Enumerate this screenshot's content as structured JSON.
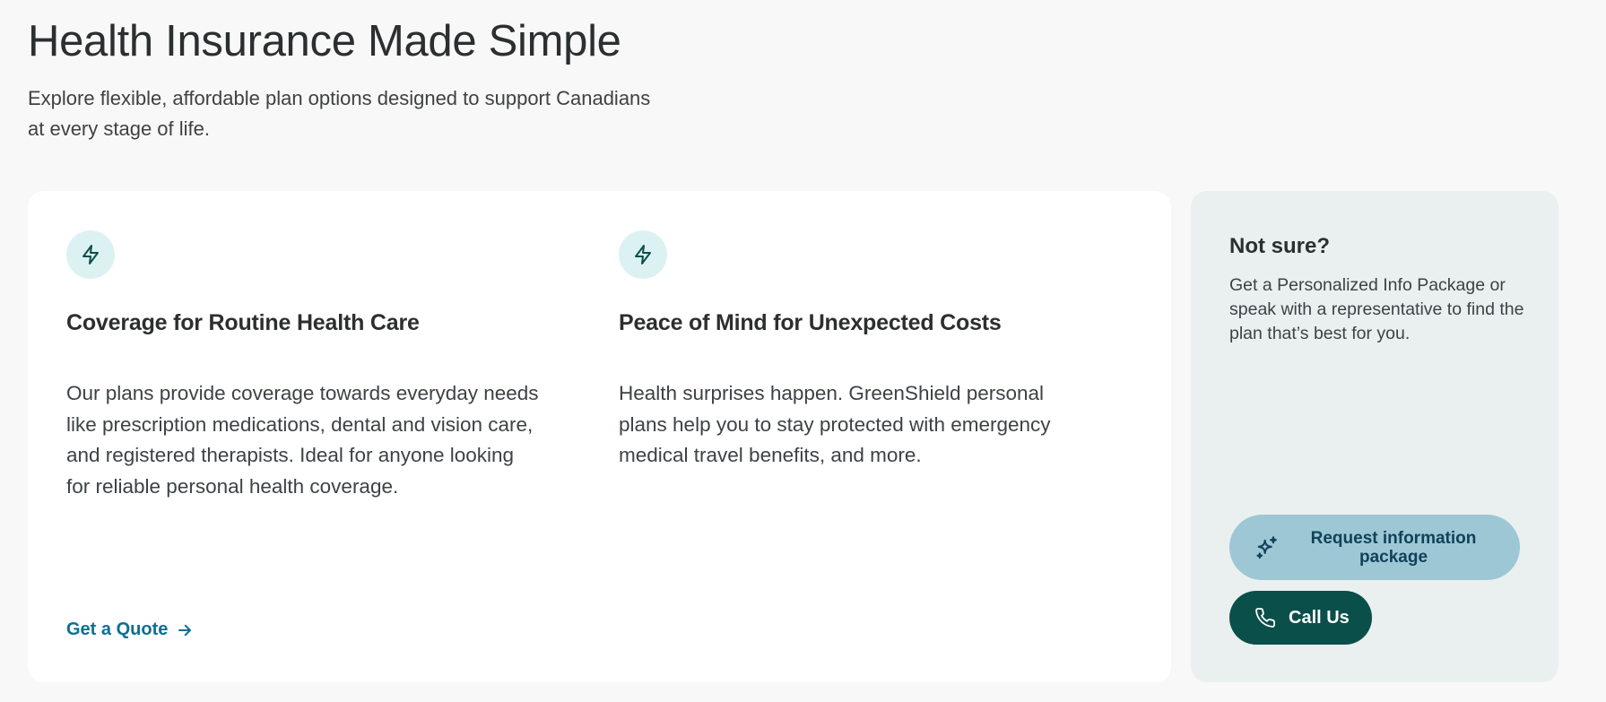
{
  "hero": {
    "title": "Health Insurance Made Simple",
    "subtitle": "Explore flexible, affordable plan options designed to support Canadians at every stage of life."
  },
  "features": [
    {
      "icon": "lightning-icon",
      "heading": "Coverage for Routine Health Care",
      "body": "Our plans provide coverage towards everyday needs like prescription medications, dental and vision care, and registered therapists. Ideal for anyone looking for reliable personal health coverage."
    },
    {
      "icon": "lightning-icon",
      "heading": "Peace of Mind for Unexpected Costs",
      "body": "Health surprises happen. GreenShield personal plans help you to stay protected with emergency medical travel benefits, and more."
    }
  ],
  "quote_link": {
    "label": "Get a Quote",
    "icon": "arrow-right-icon"
  },
  "side_panel": {
    "title": "Not sure?",
    "text": "Get a Personalized Info Package or speak with a representative to find the plan that’s best for you.",
    "info_button": {
      "label": "Request information package",
      "icon": "sparkle-icon"
    },
    "call_button": {
      "label": "Call Us",
      "icon": "phone-icon"
    }
  },
  "colors": {
    "background": "#f8f8f8",
    "icon_circle": "#dcf2f2",
    "icon_stroke": "#0b4f4a",
    "link": "#0d6f92",
    "info_button": "#9ec7d6",
    "call_button": "#0b4f4a",
    "side_panel": "#eaf0f0"
  }
}
